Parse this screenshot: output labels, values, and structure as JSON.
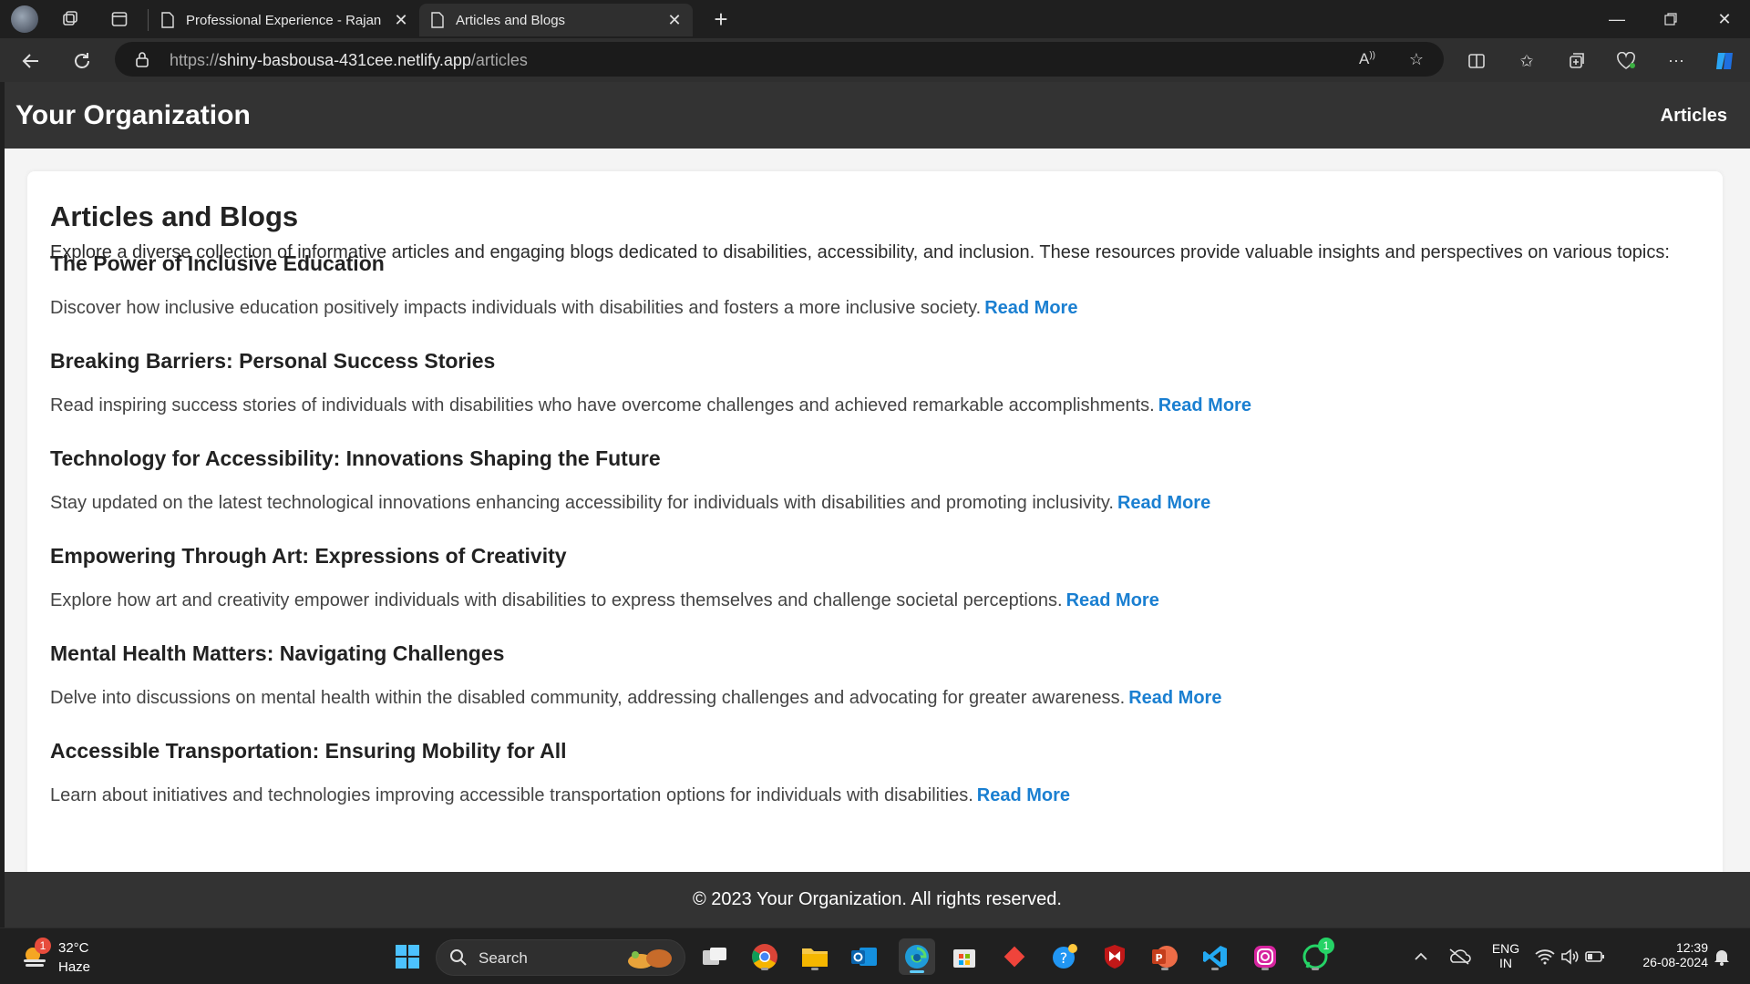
{
  "browser": {
    "tabs": [
      {
        "title": "Professional Experience - Rajan",
        "active": false
      },
      {
        "title": "Articles and Blogs",
        "active": true
      }
    ],
    "url_scheme": "https://",
    "url_host": "shiny-basbousa-431cee.netlify.app",
    "url_path": "/articles"
  },
  "site": {
    "title": "Your Organization",
    "nav": [
      "Articles"
    ]
  },
  "main": {
    "heading": "Articles and Blogs",
    "intro": "Explore a diverse collection of informative articles and engaging blogs dedicated to disabilities, accessibility, and inclusion. These resources provide valuable insights and perspectives on various topics:",
    "read_more_label": "Read More",
    "articles": [
      {
        "title": "The Power of Inclusive Education",
        "description": "Discover how inclusive education positively impacts individuals with disabilities and fosters a more inclusive society."
      },
      {
        "title": "Breaking Barriers: Personal Success Stories",
        "description": "Read inspiring success stories of individuals with disabilities who have overcome challenges and achieved remarkable accomplishments."
      },
      {
        "title": "Technology for Accessibility: Innovations Shaping the Future",
        "description": "Stay updated on the latest technological innovations enhancing accessibility for individuals with disabilities and promoting inclusivity."
      },
      {
        "title": "Empowering Through Art: Expressions of Creativity",
        "description": "Explore how art and creativity empower individuals with disabilities to express themselves and challenge societal perceptions."
      },
      {
        "title": "Mental Health Matters: Navigating Challenges",
        "description": "Delve into discussions on mental health within the disabled community, addressing challenges and advocating for greater awareness."
      },
      {
        "title": "Accessible Transportation: Ensuring Mobility for All",
        "description": "Learn about initiatives and technologies improving accessible transportation options for individuals with disabilities."
      }
    ]
  },
  "footer": {
    "text": "© 2023 Your Organization. All rights reserved."
  },
  "taskbar": {
    "weather_temp": "32°C",
    "weather_condition": "Haze",
    "weather_badge": "1",
    "search_label": "Search",
    "whatsapp_badge": "1",
    "language_line1": "ENG",
    "language_line2": "IN",
    "time": "12:39",
    "date": "26-08-2024"
  },
  "colors": {
    "header_bg": "#333333",
    "link": "#1a7fd1",
    "page_bg": "#f4f4f4",
    "card_bg": "#ffffff"
  }
}
